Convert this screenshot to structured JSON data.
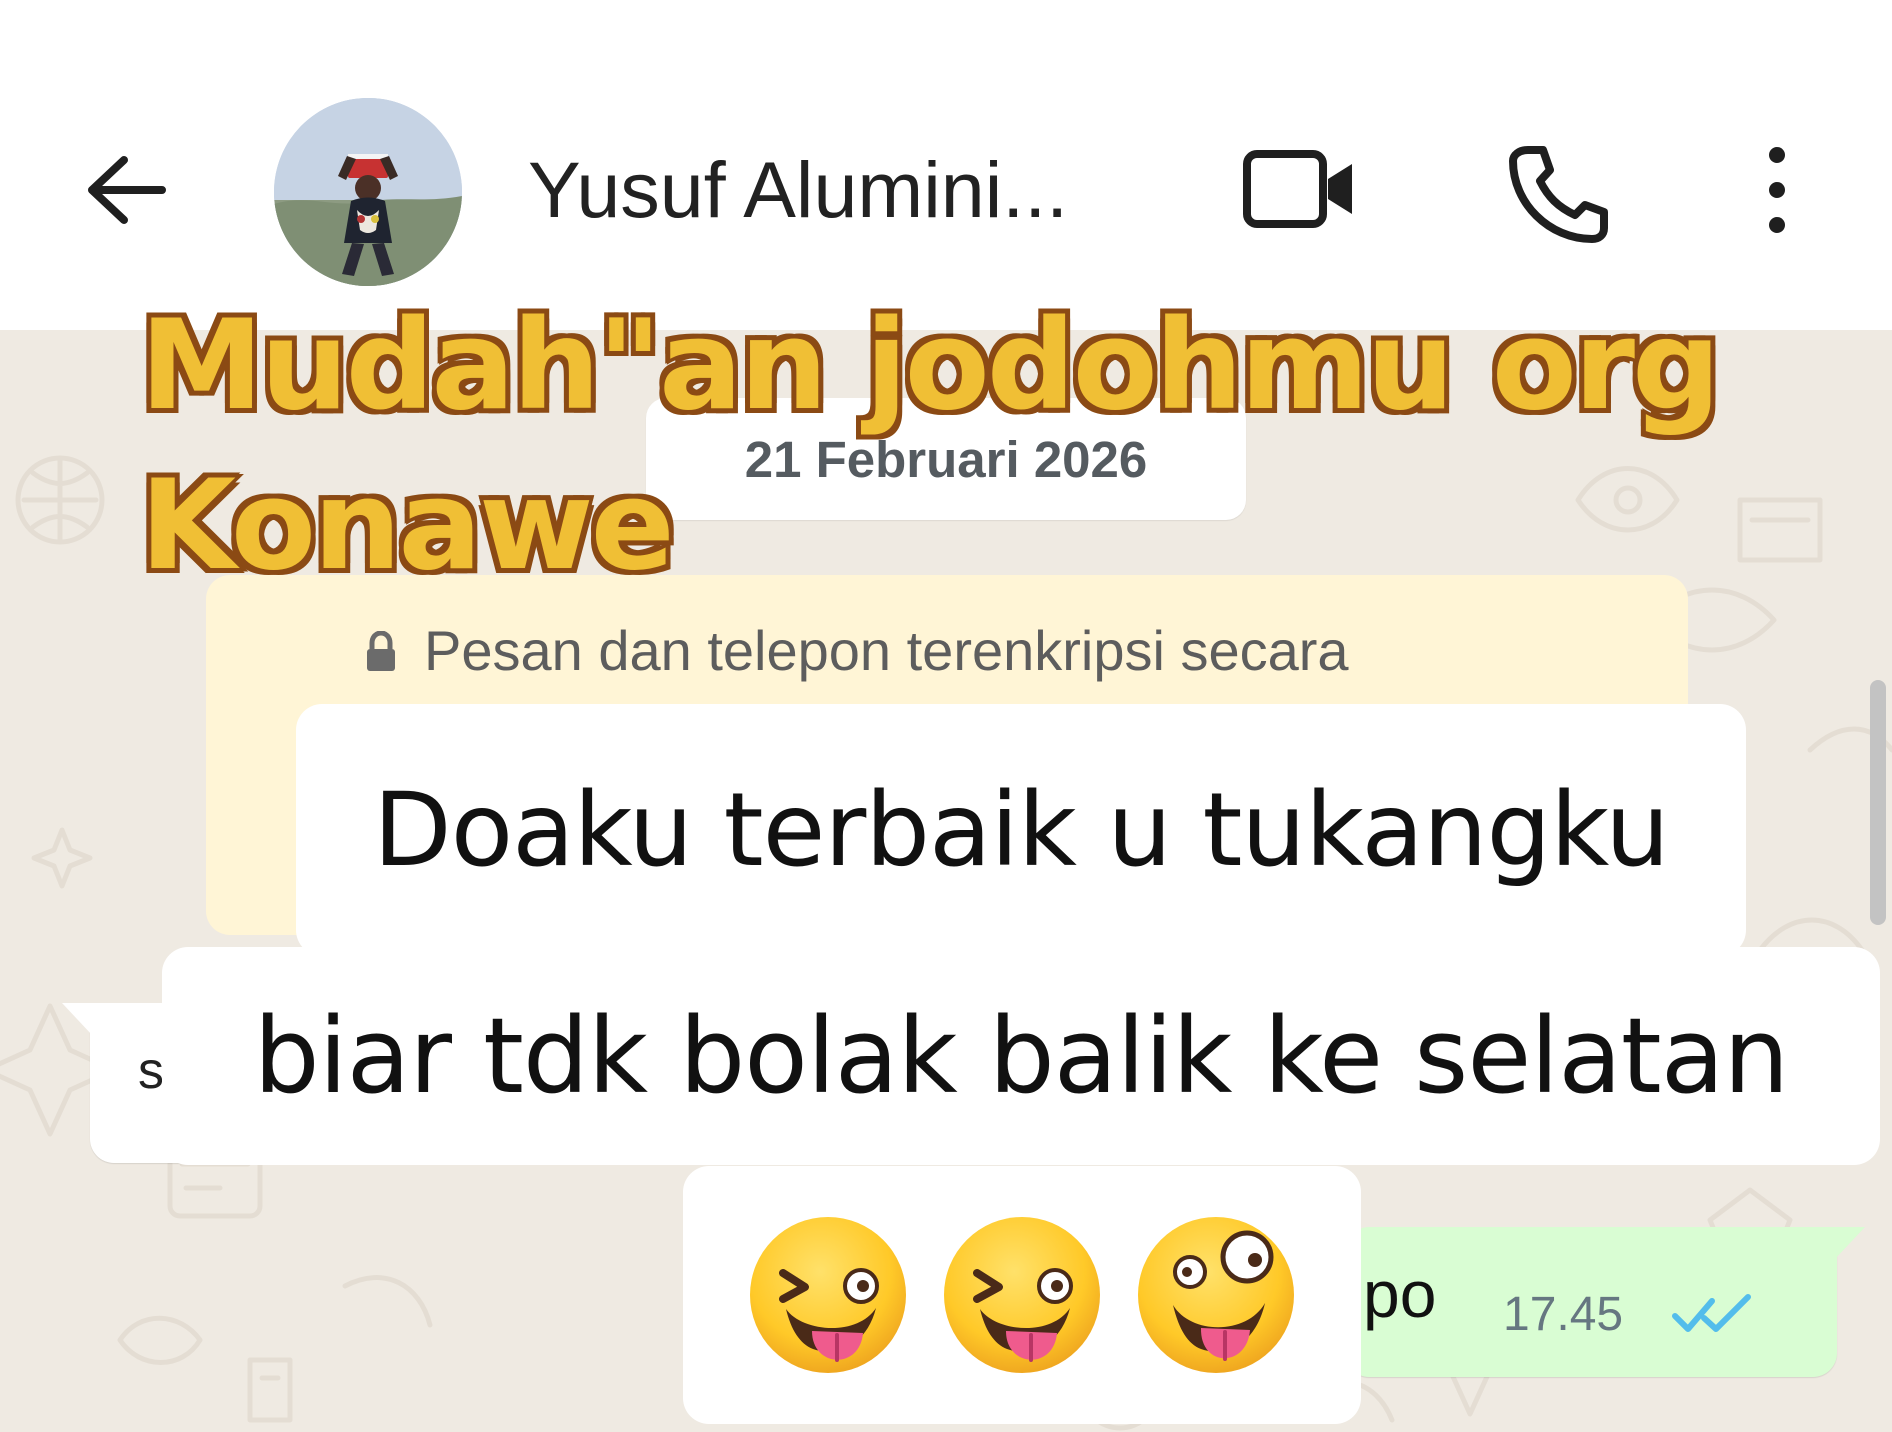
{
  "header": {
    "contact_name": "Yusuf Alumini...",
    "icons": {
      "back": "arrow-left-icon",
      "avatar": "profile-photo",
      "video": "video-camera-icon",
      "call": "phone-icon",
      "menu": "more-vertical-icon"
    },
    "colors": {
      "background": "#ffffff",
      "text": "#222222"
    }
  },
  "chat": {
    "date_label": "21 Februari 2026",
    "encryption_notice": "Pesan dan telepon terenkripsi secara",
    "incoming_partial_text": "s",
    "outgoing_message": {
      "text": "po",
      "time": "17.45",
      "status": "read",
      "status_icon": "double-check-icon"
    },
    "colors": {
      "chat_background": "#efeae2",
      "outgoing_bubble": "#d9fdd3",
      "incoming_bubble": "#ffffff",
      "encryption_notice": "#fff5d6",
      "read_check": "#53bdeb"
    }
  },
  "overlay": {
    "headline": {
      "line_1": "Mudah\"an jodohmu org",
      "line_2": "Konawe",
      "colors": {
        "fill": "#f0bf35",
        "outline": "#8b4a14"
      }
    },
    "captions": {
      "line_1": "Doaku terbaik u tukangku",
      "line_2": "biar tdk bolak balik ke selatan",
      "emoji_names": [
        "winking-face-with-tongue",
        "winking-face-with-tongue",
        "zany-face"
      ]
    }
  }
}
